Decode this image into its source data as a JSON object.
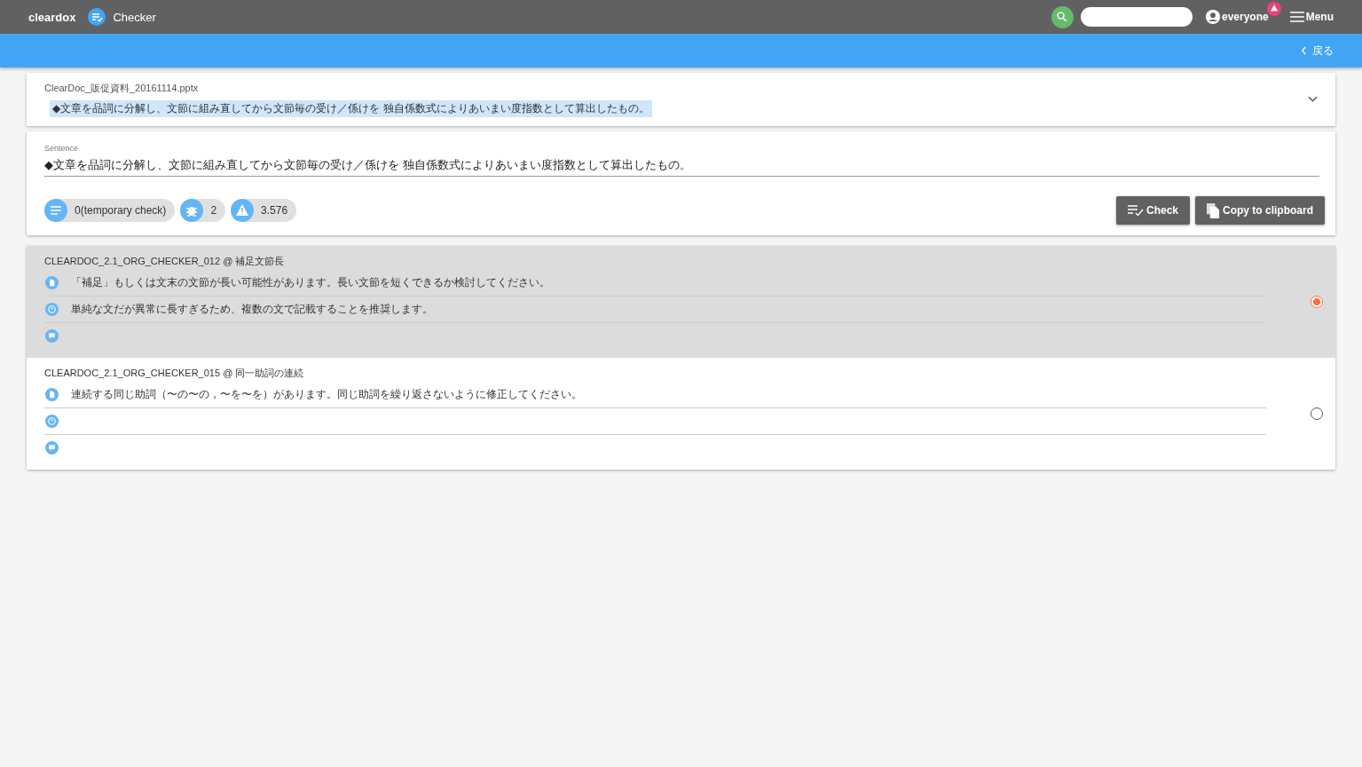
{
  "topbar": {
    "brand": "cleardox",
    "app": "Checker",
    "user": "everyone",
    "alert": true,
    "menu": "Menu"
  },
  "subbar": {
    "back": "戻る"
  },
  "document": {
    "filename": "ClearDoc_販促資料_20161114.pptx",
    "excerpt": "◆文章を品詞に分解し、文節に組み直してから文節毎の受け／係けを 独自係数式によりあいまい度指数として算出したもの。",
    "expanded": false
  },
  "sentence": {
    "label": "Sentence",
    "value": "◆文章を品詞に分解し、文節に組み直してから文節毎の受け／係けを 独自係数式によりあいまい度指数として算出したもの。"
  },
  "chips": [
    {
      "kind": "list",
      "text": "0(temporary check)"
    },
    {
      "kind": "bug",
      "text": "2"
    },
    {
      "kind": "warning",
      "text": "3.576"
    }
  ],
  "buttons": [
    {
      "kind": "check",
      "label": "Check"
    },
    {
      "kind": "copy",
      "label": "Copy to clipboard"
    }
  ],
  "results": [
    {
      "title": "CLEARDOC_2.1_ORG_CHECKER_012 @ 補足文節長",
      "selected": true,
      "lines": [
        {
          "kind": "document",
          "text": "「補足」もしくは文末の文節が長い可能性があります。長い文節を短くできるか検討してください。"
        },
        {
          "kind": "help",
          "text": "単純な文だが異常に長すぎるため、複数の文で記載することを推奨します。"
        },
        {
          "kind": "comment"
        }
      ]
    },
    {
      "title": "CLEARDOC_2.1_ORG_CHECKER_015 @ 同一助詞の連続",
      "selected": false,
      "lines": [
        {
          "kind": "document",
          "text": "連続する同じ助詞（〜の〜の，〜を〜を）があります。同じ助詞を繰り返さないように修正してください。"
        },
        {
          "kind": "help"
        },
        {
          "kind": "comment"
        }
      ]
    }
  ]
}
